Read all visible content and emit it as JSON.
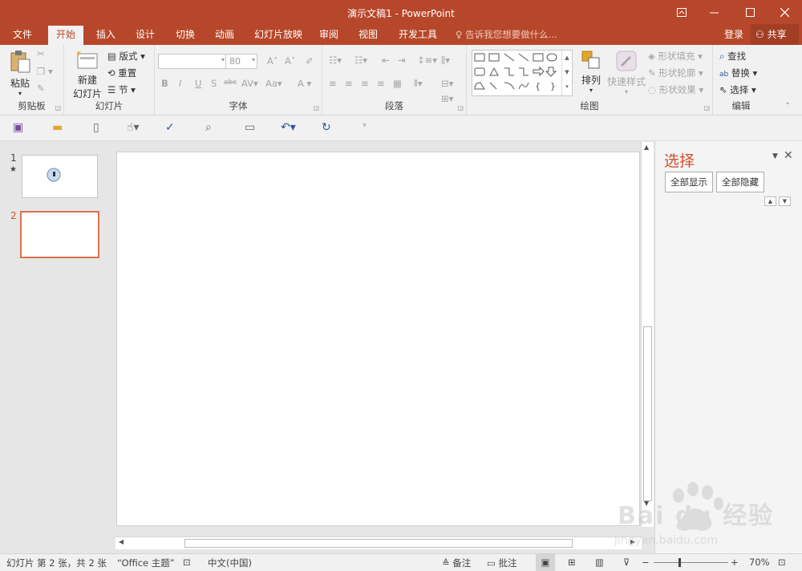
{
  "titlebar": {
    "title": "演示文稿1 - PowerPoint"
  },
  "tabs": [
    {
      "label": "文件"
    },
    {
      "label": "开始"
    },
    {
      "label": "插入"
    },
    {
      "label": "设计"
    },
    {
      "label": "切换"
    },
    {
      "label": "动画"
    },
    {
      "label": "幻灯片放映"
    },
    {
      "label": "审阅"
    },
    {
      "label": "视图"
    },
    {
      "label": "开发工具"
    }
  ],
  "tellme": "告诉我您想要做什么...",
  "account": {
    "login": "登录",
    "share": "共享"
  },
  "ribbon": {
    "clipboard": {
      "label": "剪贴板",
      "paste": "粘贴"
    },
    "slides": {
      "label": "幻灯片",
      "new_slide_line1": "新建",
      "new_slide_line2": "幻灯片",
      "layout": "版式",
      "reset": "重置",
      "section": "节"
    },
    "font": {
      "label": "字体",
      "size": "80"
    },
    "paragraph": {
      "label": "段落"
    },
    "drawing": {
      "label": "绘图",
      "arrange": "排列",
      "quick_styles": "快速样式",
      "fill": "形状填充",
      "outline": "形状轮廓",
      "effects": "形状效果"
    },
    "editing": {
      "label": "编辑",
      "find": "查找",
      "replace": "替换",
      "select": "选择"
    }
  },
  "thumbnails": [
    {
      "number": "1",
      "star": "★"
    },
    {
      "number": "2"
    }
  ],
  "selection_pane": {
    "title": "选择",
    "show_all": "全部显示",
    "hide_all": "全部隐藏"
  },
  "status": {
    "slide_info": "幻灯片 第 2 张，共 2 张",
    "theme": "“Office 主题”",
    "language": "中文(中国)",
    "notes": "备注",
    "comments": "批注",
    "zoom": "70%"
  },
  "watermark": {
    "brand": "Bai du 经验",
    "url": "jingyan.baidu.com"
  },
  "colors": {
    "accent": "#b7472a",
    "selection": "#e0704f",
    "pane_title": "#d35230"
  }
}
